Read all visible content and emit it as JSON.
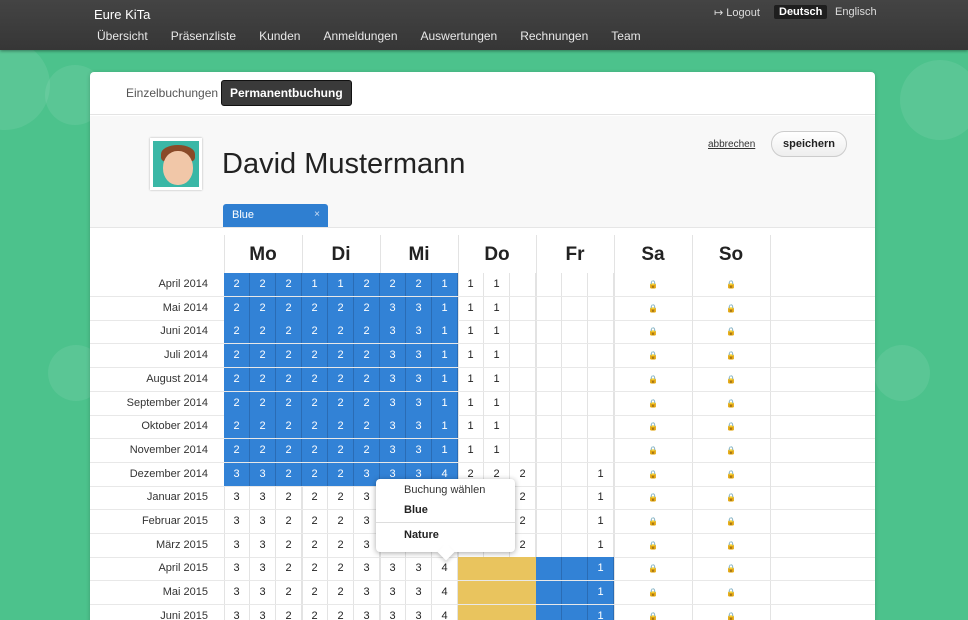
{
  "app": {
    "brand": "Eure KiTa"
  },
  "nav": [
    "Übersicht",
    "Präsenzliste",
    "Kunden",
    "Anmeldungen",
    "Auswertungen",
    "Rechnungen",
    "Team"
  ],
  "top": {
    "logout": "Logout",
    "lang_active": "Deutsch",
    "lang_other": "Englisch"
  },
  "tabs": {
    "single": "Einzelbuchungen",
    "permanent": "Permanentbuchung"
  },
  "profile": {
    "name": "David Mustermann",
    "cancel": "abbrechen",
    "save": "speichern",
    "tag": "Blue",
    "tag_close": "×"
  },
  "days": [
    "Mo",
    "Di",
    "Mi",
    "Do",
    "Fr",
    "Sa",
    "So"
  ],
  "popup": {
    "title": "Buchung wählen",
    "option1": "Blue",
    "option2": "Nature"
  },
  "colors": {
    "blue": "#3282d6",
    "yellow": "#e9c45e",
    "bg": "#4cc28c"
  },
  "rows": [
    {
      "label": "April 2014",
      "cells": [
        "2",
        "2",
        "2",
        "1",
        "1",
        "2",
        "2",
        "2",
        "1",
        "1",
        "1",
        "",
        "",
        ""
      ],
      "blue": 9,
      "yellowFrom": -1,
      "blueAfter": []
    },
    {
      "label": "Mai 2014",
      "cells": [
        "2",
        "2",
        "2",
        "2",
        "2",
        "2",
        "3",
        "3",
        "1",
        "1",
        "1",
        "",
        "",
        ""
      ],
      "blue": 9,
      "blueAfter": []
    },
    {
      "label": "Juni 2014",
      "cells": [
        "2",
        "2",
        "2",
        "2",
        "2",
        "2",
        "3",
        "3",
        "1",
        "1",
        "1",
        "",
        "",
        ""
      ],
      "blue": 9,
      "blueAfter": []
    },
    {
      "label": "Juli 2014",
      "cells": [
        "2",
        "2",
        "2",
        "2",
        "2",
        "2",
        "3",
        "3",
        "1",
        "1",
        "1",
        "",
        "",
        ""
      ],
      "blue": 9,
      "blueAfter": []
    },
    {
      "label": "August 2014",
      "cells": [
        "2",
        "2",
        "2",
        "2",
        "2",
        "2",
        "3",
        "3",
        "1",
        "1",
        "1",
        "",
        "",
        ""
      ],
      "blue": 9,
      "blueAfter": []
    },
    {
      "label": "September 2014",
      "cells": [
        "2",
        "2",
        "2",
        "2",
        "2",
        "2",
        "3",
        "3",
        "1",
        "1",
        "1",
        "",
        "",
        ""
      ],
      "blue": 9,
      "blueAfter": []
    },
    {
      "label": "Oktober 2014",
      "cells": [
        "2",
        "2",
        "2",
        "2",
        "2",
        "2",
        "3",
        "3",
        "1",
        "1",
        "1",
        "",
        "",
        ""
      ],
      "blue": 9,
      "blueAfter": []
    },
    {
      "label": "November 2014",
      "cells": [
        "2",
        "2",
        "2",
        "2",
        "2",
        "2",
        "3",
        "3",
        "1",
        "1",
        "1",
        "",
        "",
        ""
      ],
      "blue": 9,
      "blueAfter": []
    },
    {
      "label": "Dezember 2014",
      "cells": [
        "3",
        "3",
        "2",
        "2",
        "2",
        "3",
        "3",
        "3",
        "4",
        "2",
        "2",
        "2",
        "",
        "",
        "1"
      ],
      "blue": 9,
      "blueAfter": []
    },
    {
      "label": "Januar 2015",
      "cells": [
        "3",
        "3",
        "2",
        "2",
        "2",
        "3",
        "3",
        "3",
        "4",
        "2",
        "2",
        "2",
        "",
        "",
        "1"
      ],
      "blue": 0,
      "blueAfter": []
    },
    {
      "label": "Februar 2015",
      "cells": [
        "3",
        "3",
        "2",
        "2",
        "2",
        "3",
        "3",
        "3",
        "4",
        "2",
        "2",
        "2",
        "",
        "",
        "1"
      ],
      "blue": 0,
      "blueAfter": []
    },
    {
      "label": "März 2015",
      "cells": [
        "3",
        "3",
        "2",
        "2",
        "2",
        "3",
        "3",
        "3",
        "4",
        "2",
        "2",
        "2",
        "",
        "",
        "1"
      ],
      "blue": 0,
      "blueAfter": []
    },
    {
      "label": "April 2015",
      "cells": [
        "3",
        "3",
        "2",
        "2",
        "2",
        "3",
        "3",
        "3",
        "4",
        "",
        "",
        "",
        "",
        "",
        "1"
      ],
      "blue": 0,
      "yellow": true
    },
    {
      "label": "Mai 2015",
      "cells": [
        "3",
        "3",
        "2",
        "2",
        "2",
        "3",
        "3",
        "3",
        "4",
        "",
        "",
        "",
        "",
        "",
        "1"
      ],
      "blue": 0,
      "yellow": true
    },
    {
      "label": "Juni 2015",
      "cells": [
        "3",
        "3",
        "2",
        "2",
        "2",
        "3",
        "3",
        "3",
        "4",
        "",
        "",
        "",
        "",
        "",
        "1"
      ],
      "blue": 0,
      "yellow": true
    }
  ]
}
